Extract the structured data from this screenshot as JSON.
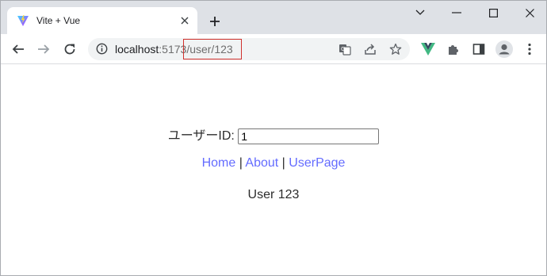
{
  "tab": {
    "title": "Vite + Vue"
  },
  "address": {
    "host": "localhost",
    "port": ":5173",
    "path": "/user/123"
  },
  "page": {
    "user_id_label": "ユーザーID:",
    "user_id_value": "1",
    "nav": {
      "home": "Home",
      "sep1": " | ",
      "about": "About",
      "sep2": " | ",
      "userpage": "UserPage"
    },
    "user_text": "User 123"
  },
  "colors": {
    "link": "#646cff",
    "tabstrip": "#dee1e6",
    "highlight": "#d0312d"
  }
}
